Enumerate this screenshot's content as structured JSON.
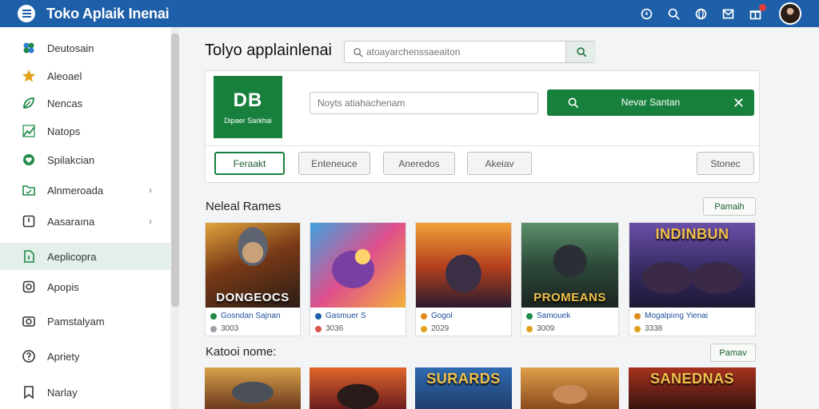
{
  "header": {
    "title": "Toko Aplaik Inenai",
    "icons": [
      "compass-icon",
      "search-icon",
      "globe-icon",
      "inbox-icon",
      "gift-icon"
    ]
  },
  "sidebar": {
    "items": [
      {
        "label": "Deutosain",
        "icon": "puzzle-icon"
      },
      {
        "label": "Aleoael",
        "icon": "star-icon"
      },
      {
        "label": "Nencas",
        "icon": "leaf-icon"
      },
      {
        "label": "Natops",
        "icon": "chart-icon"
      },
      {
        "label": "Spilakcian",
        "icon": "heart-icon"
      },
      {
        "label": "Alnmeroada",
        "icon": "folder-icon",
        "chevron": "›"
      },
      {
        "label": "Aasaraına",
        "icon": "square-icon",
        "chevron": "›"
      },
      {
        "label": "Aeplicopra",
        "icon": "document-icon"
      },
      {
        "label": "Apopis",
        "icon": "circle-icon"
      },
      {
        "label": "Pamstalyam",
        "icon": "camera-icon"
      },
      {
        "label": "Apriety",
        "icon": "help-icon"
      },
      {
        "label": "Narlay",
        "icon": "bookmark-icon"
      }
    ]
  },
  "main": {
    "page_title": "Tolyo applainlenai",
    "search": {
      "value": "atoayarchenssaeaiton"
    },
    "panel": {
      "logo_mark": "DB",
      "logo_sub": "Dipaer Sarkhai",
      "input_placeholder": "Noyts atiahachenam",
      "primary_button": "Nevar Santan",
      "filters": [
        "Feraakt",
        "Enteneuce",
        "Aneredos",
        "Akeiav",
        "Stonec"
      ]
    },
    "section1": {
      "title": "Neleal Rames",
      "more": "Pamaih",
      "cards": [
        {
          "title": "Gosndan Sajnan",
          "meta": "3003",
          "caption": "DONGEOCS",
          "title_dot": "#1f8a48",
          "meta_dot": "#9aa0a6"
        },
        {
          "title": "Gasmuer S",
          "meta": "3036",
          "caption": "",
          "title_dot": "#1d5fa8",
          "meta_dot": "#d9534f"
        },
        {
          "title": "Gogol",
          "meta": "2029",
          "caption": "",
          "title_dot": "#e08a1e",
          "meta_dot": "#e0a21e"
        },
        {
          "title": "Samouek",
          "meta": "3009",
          "caption": "PROMEANS",
          "title_dot": "#1f8a48",
          "meta_dot": "#e0a21e"
        },
        {
          "title": "Mogalpiıng Yienai",
          "meta": "3338",
          "caption": "INDINBUN",
          "title_dot": "#e08a1e",
          "meta_dot": "#e0a21e"
        }
      ]
    },
    "section2": {
      "title": "Katooi nome:",
      "more": "Pamav",
      "captions": [
        "",
        "",
        "SURARDS",
        "",
        "SANEDNAS"
      ]
    }
  }
}
